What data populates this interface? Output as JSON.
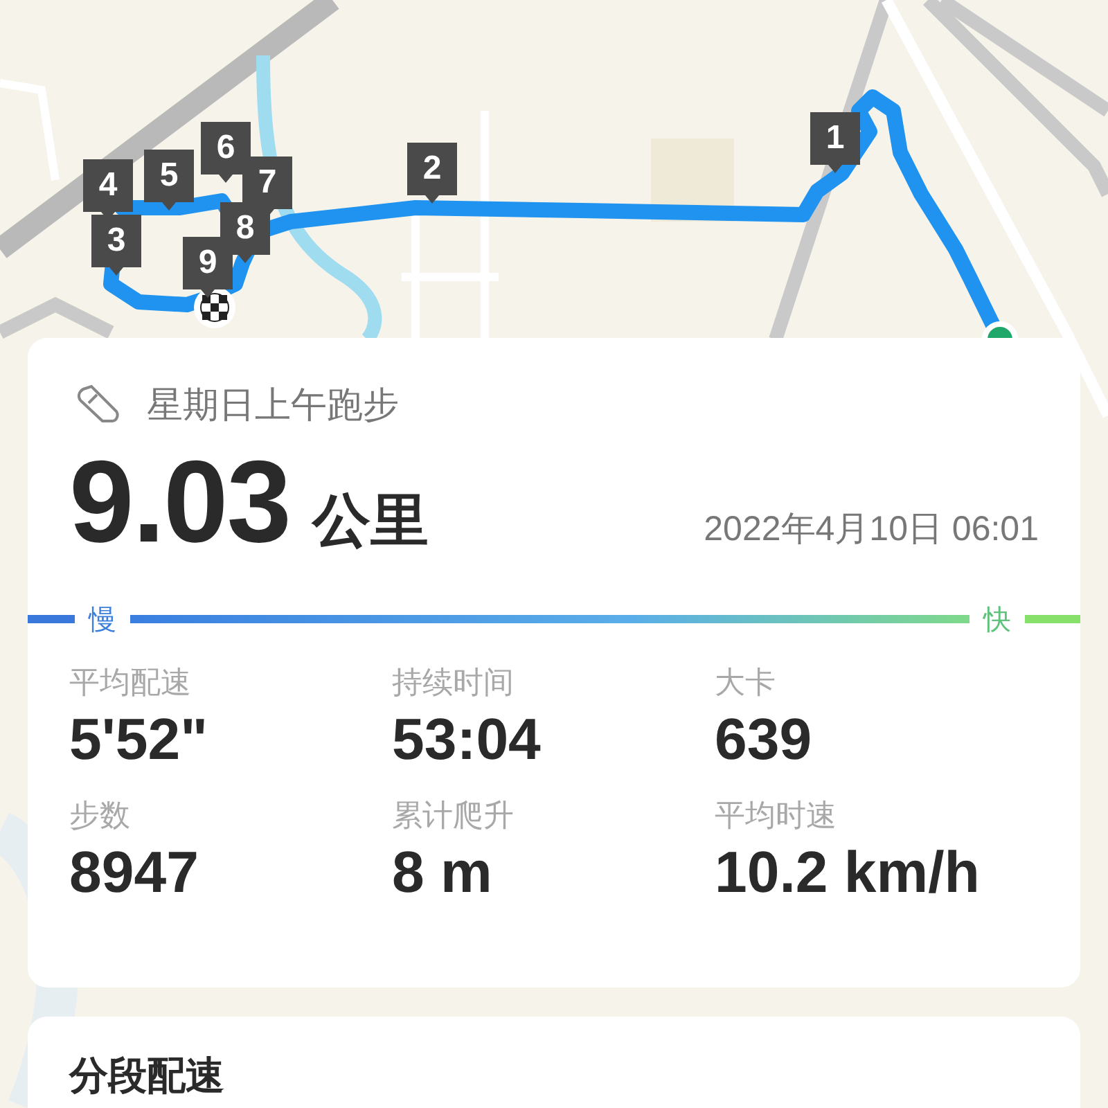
{
  "map": {
    "kind": "picture",
    "markers": [
      {
        "label": "1"
      },
      {
        "label": "2"
      },
      {
        "label": "3"
      },
      {
        "label": "4"
      },
      {
        "label": "5"
      },
      {
        "label": "6"
      },
      {
        "label": "7"
      },
      {
        "label": "8"
      },
      {
        "label": "9"
      }
    ]
  },
  "activity": {
    "title": "星期日上午跑步",
    "distance": "9.03",
    "unit": "公里",
    "datetime": "2022年4月10日 06:01"
  },
  "pace_scale": {
    "slow": "慢",
    "fast": "快"
  },
  "stats": [
    {
      "label": "平均配速",
      "value": "5'52\""
    },
    {
      "label": "持续时间",
      "value": "53:04"
    },
    {
      "label": "大卡",
      "value": "639"
    },
    {
      "label": "步数",
      "value": "8947"
    },
    {
      "label": "累计爬升",
      "value": "8 m"
    },
    {
      "label": "平均时速",
      "value": "10.2 km/h"
    }
  ],
  "splits": {
    "title": "分段配速"
  }
}
